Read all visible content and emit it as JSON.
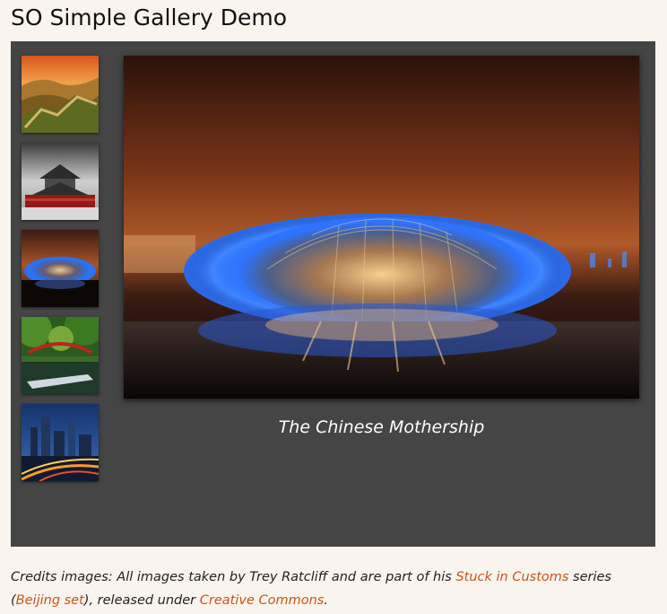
{
  "page": {
    "title": "SO Simple Gallery Demo"
  },
  "gallery": {
    "thumbnails": [
      {
        "name": "great-wall-thumbnail"
      },
      {
        "name": "drum-tower-thumbnail"
      },
      {
        "name": "chinese-mothership-thumbnail"
      },
      {
        "name": "garden-bridge-thumbnail"
      },
      {
        "name": "city-night-thumbnail"
      }
    ],
    "main_photo": {
      "name": "chinese-mothership-photo"
    },
    "caption": "The Chinese Mothership"
  },
  "credits": {
    "prefix": "Credits images: All images taken by Trey Ratcliff and are part of his ",
    "stuck_link": "Stuck in Customs",
    "middle": " series (",
    "beijing_link": "Beijing set",
    "middle2": "), released under ",
    "cc_link": "Creative Commons",
    "suffix": "."
  },
  "colors": {
    "background": "#faf4ef",
    "gallery_bg": "#454545",
    "link": "#c8551b"
  }
}
